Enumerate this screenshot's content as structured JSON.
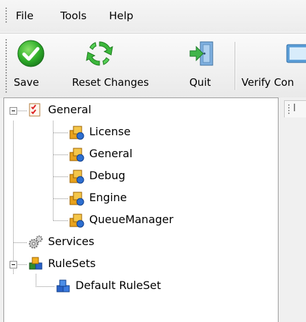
{
  "menubar": {
    "items": [
      "File",
      "Tools",
      "Help"
    ]
  },
  "toolbar": {
    "buttons": [
      {
        "label": "Save",
        "icon": "check-icon"
      },
      {
        "label": "Reset Changes",
        "icon": "refresh-icon"
      },
      {
        "label": "Quit",
        "icon": "exit-door-icon"
      },
      {
        "label": "Verify Con",
        "icon": "verify-config-icon"
      }
    ]
  },
  "tree": {
    "general": {
      "label": "General",
      "icon": "checklist-icon"
    },
    "general_children": [
      "License",
      "General",
      "Debug",
      "Engine",
      "QueueManager"
    ],
    "services": {
      "label": "Services",
      "icon": "gears-icon"
    },
    "rulesets": {
      "label": "RuleSets",
      "icon": "cubes-icon"
    },
    "rulesets_children": [
      "Default RuleSet"
    ]
  },
  "right_panel": {
    "tab_fragment": "I"
  }
}
